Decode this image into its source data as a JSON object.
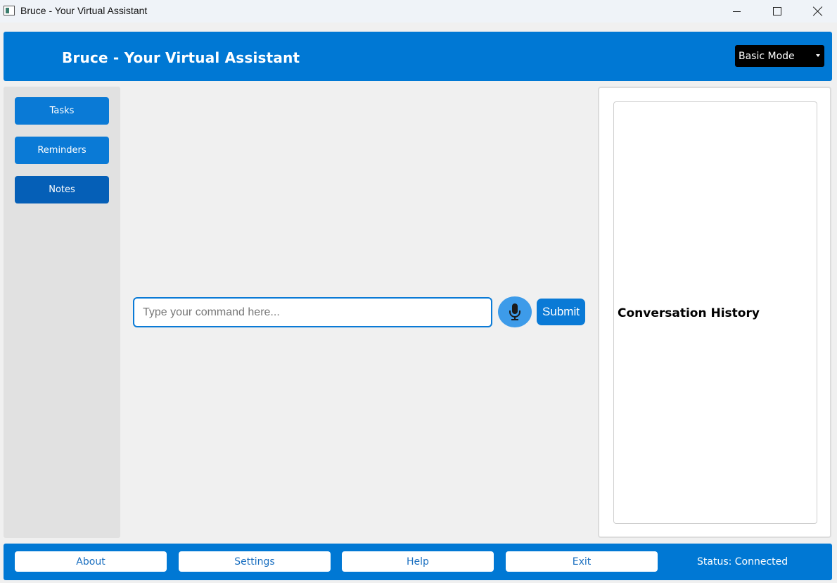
{
  "window": {
    "title": "Bruce - Your Virtual Assistant"
  },
  "header": {
    "title": "Bruce - Your Virtual Assistant",
    "mode_selected": "Basic Mode"
  },
  "sidebar": {
    "items": [
      {
        "label": "Tasks"
      },
      {
        "label": "Reminders"
      },
      {
        "label": "Notes"
      }
    ]
  },
  "command": {
    "placeholder": "Type your command here...",
    "value": "",
    "mic_icon": "microphone-icon",
    "submit_label": "Submit"
  },
  "conversation": {
    "title": "Conversation History"
  },
  "footer": {
    "buttons": [
      {
        "label": "About"
      },
      {
        "label": "Settings"
      },
      {
        "label": "Help"
      },
      {
        "label": "Exit"
      }
    ],
    "status": "Status: Connected"
  },
  "colors": {
    "primary": "#0078d4",
    "button": "#0a7ad6",
    "button_active": "#055fb7",
    "mic": "#3d9be9",
    "sidebar_bg": "#e1e1e1",
    "app_bg": "#f0f0f0"
  }
}
